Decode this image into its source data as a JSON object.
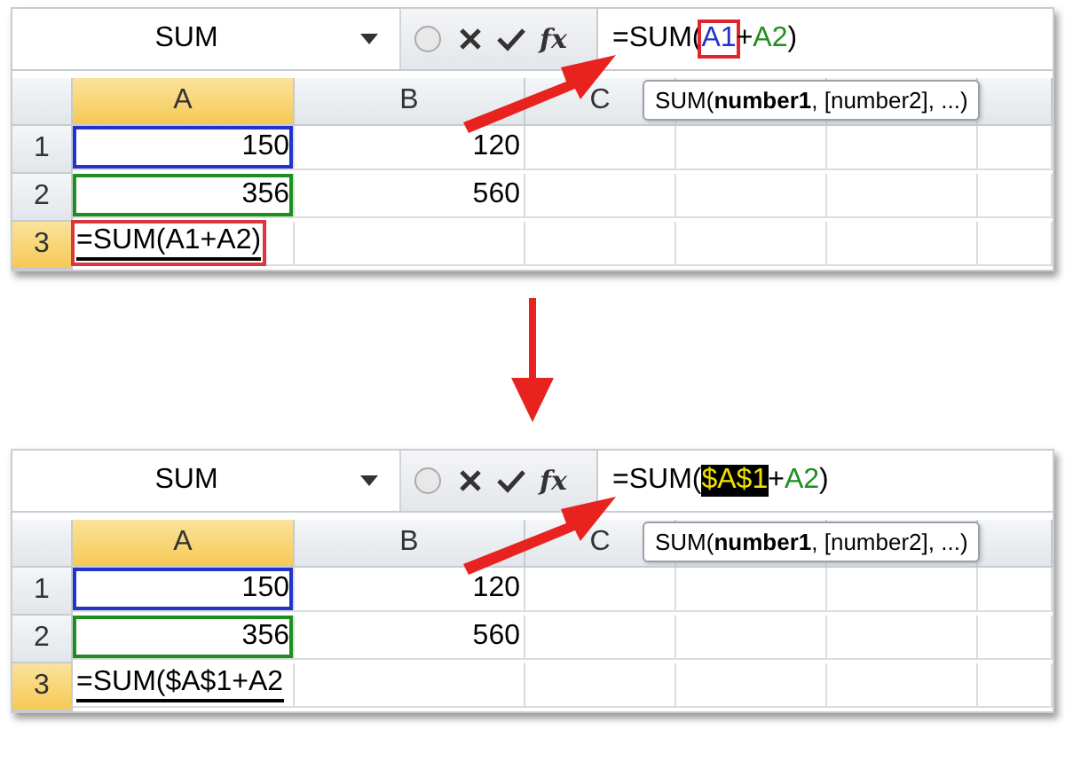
{
  "panels": [
    {
      "name_box": "SUM",
      "function_button": "fx",
      "formula": [
        {
          "text": "=SUM(",
          "kind": "plain"
        },
        {
          "text": "A1",
          "kind": "ref",
          "color": "#2233cc",
          "boxed": true
        },
        {
          "text": "+",
          "kind": "plain"
        },
        {
          "text": "A2",
          "kind": "ref",
          "color": "#1e8f1e",
          "boxed": false
        },
        {
          "text": ")",
          "kind": "plain"
        }
      ],
      "tooltip": "SUM(**number1**, [number2], ...)",
      "columns": [
        {
          "label": "A",
          "selected": true
        },
        {
          "label": "B",
          "selected": false
        },
        {
          "label": "C",
          "selected": false
        }
      ],
      "rows": [
        {
          "label": "1",
          "selected": false,
          "cells": [
            {
              "text": "150",
              "kind": "number",
              "color": "#2233cc",
              "boxed": false
            },
            {
              "text": "120",
              "kind": "number",
              "boxed": false
            }
          ]
        },
        {
          "label": "2",
          "selected": false,
          "cells": [
            {
              "text": "356",
              "kind": "number",
              "color": "#1e8f1e",
              "boxed": false
            },
            {
              "text": "560",
              "kind": "number",
              "boxed": false
            }
          ]
        },
        {
          "label": "3",
          "selected": true,
          "cells": [
            {
              "text": "=SUM(A1+A2)",
              "kind": "formula",
              "boxed": true
            }
          ]
        }
      ]
    },
    {
      "name_box": "SUM",
      "function_button": "fx",
      "formula": [
        {
          "text": "=SUM(",
          "kind": "plain"
        },
        {
          "text": "$A$1",
          "kind": "highlight",
          "boxed": false
        },
        {
          "text": "+",
          "kind": "plain"
        },
        {
          "text": "A2",
          "kind": "ref",
          "color": "#1e8f1e",
          "boxed": false
        },
        {
          "text": ")",
          "kind": "plain"
        }
      ],
      "tooltip": "SUM(**number1**, [number2], ...)",
      "columns": [
        {
          "label": "A",
          "selected": true
        },
        {
          "label": "B",
          "selected": false
        },
        {
          "label": "C",
          "selected": false
        }
      ],
      "rows": [
        {
          "label": "1",
          "selected": false,
          "cells": [
            {
              "text": "150",
              "kind": "number",
              "color": "#2233cc",
              "boxed": false
            },
            {
              "text": "120",
              "kind": "number",
              "boxed": false
            }
          ]
        },
        {
          "label": "2",
          "selected": false,
          "cells": [
            {
              "text": "356",
              "kind": "number",
              "color": "#1e8f1e",
              "boxed": false
            },
            {
              "text": "560",
              "kind": "number",
              "boxed": false
            }
          ]
        },
        {
          "label": "3",
          "selected": true,
          "cells": [
            {
              "text": "=SUM($A$1+A2",
              "kind": "formula",
              "boxed": false
            }
          ]
        }
      ]
    }
  ]
}
